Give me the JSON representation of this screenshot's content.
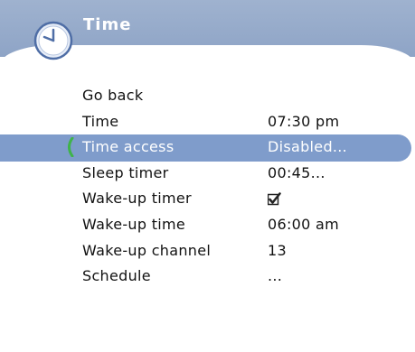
{
  "header": {
    "title": "Time",
    "icon": "clock-icon",
    "color": "#93a8c9"
  },
  "menu": {
    "highlight_color": "#7f9ccb",
    "items": [
      {
        "label": "Go back",
        "value": ""
      },
      {
        "label": "Time",
        "value": "07:30 pm"
      },
      {
        "label": "Time access",
        "value": "Disabled...",
        "selected": true
      },
      {
        "label": "Sleep timer",
        "value": "00:45..."
      },
      {
        "label": "Wake-up timer",
        "value": "",
        "checked": true
      },
      {
        "label": "Wake-up time",
        "value": "06:00 am"
      },
      {
        "label": "Wake-up channel",
        "value": "13"
      },
      {
        "label": "Schedule",
        "value": "..."
      }
    ]
  }
}
